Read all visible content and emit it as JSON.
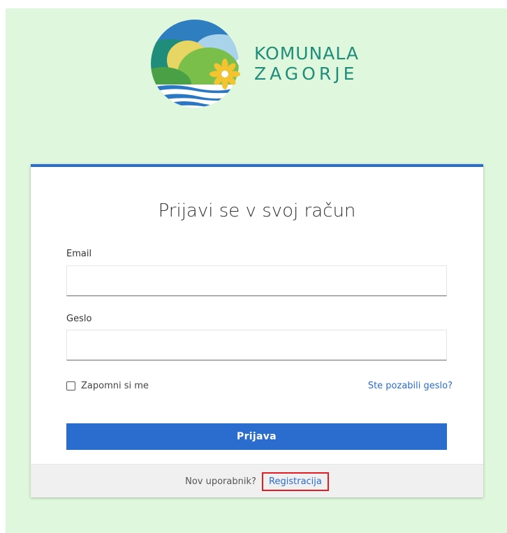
{
  "brand": {
    "name_line1": "KOMUNALA",
    "name_line2": "ZAGORJE",
    "colors": {
      "logo_text": "#1f8d7a",
      "sun": "#f4c430",
      "hill_dark": "#1f8d7a",
      "hill_light": "#7bbf4b",
      "water": "#2a78c4"
    }
  },
  "login": {
    "title": "Prijavi se v svoj račun",
    "email": {
      "label": "Email",
      "value": "",
      "placeholder": ""
    },
    "password": {
      "label": "Geslo",
      "value": "",
      "placeholder": ""
    },
    "remember_label": "Zapomni si me",
    "remember_checked": false,
    "forgot_link": "Ste pozabili geslo?",
    "submit_label": "Prijava"
  },
  "footer": {
    "prompt": "Nov uporabnik?",
    "register_link": "Registracija"
  },
  "colors": {
    "background": "#dff8dd",
    "accent": "#2b6ccf",
    "highlight": "#e01e24"
  }
}
